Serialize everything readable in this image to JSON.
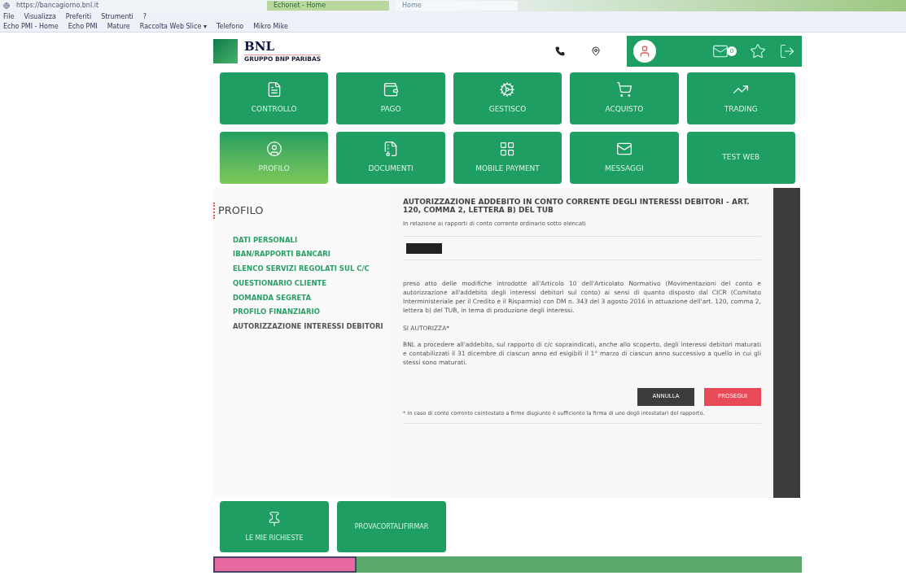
{
  "browser": {
    "address": "https://bancagiorno.bnl.it",
    "tabs": [
      {
        "label": "Echonet - Home",
        "selected": true
      },
      {
        "label": "Home",
        "selected": false
      }
    ],
    "menu": [
      "File",
      "Visualizza",
      "Preferiti",
      "Strumenti",
      "?"
    ],
    "bookmarks": [
      "Echo PMI - Home",
      "Echo PMI",
      "Mature",
      "Raccolta Web Slice ▾",
      "Telefono",
      "Mikro Mike"
    ]
  },
  "header": {
    "logo_name": "BNL",
    "logo_tagline": "GRUPPO BNP PARIBAS",
    "messages_badge": "0"
  },
  "tiles": [
    {
      "label": "CONTROLLO",
      "selected": false
    },
    {
      "label": "PAGO",
      "selected": false
    },
    {
      "label": "GESTISCO",
      "selected": false
    },
    {
      "label": "ACQUISTO",
      "selected": false
    },
    {
      "label": "TRADING",
      "selected": false
    },
    {
      "label": "PROFILO",
      "selected": true
    },
    {
      "label": "DOCUMENTI",
      "selected": false
    },
    {
      "label": "MOBILE PAYMENT",
      "selected": false
    },
    {
      "label": "MESSAGGI",
      "selected": false
    },
    {
      "label": "TEST WEB",
      "selected": false
    }
  ],
  "sidebar": {
    "title": "PROFILO",
    "items": [
      {
        "label": "DATI PERSONALI",
        "selected": false
      },
      {
        "label": "IBAN/RAPPORTI BANCARI",
        "selected": false
      },
      {
        "label": "ELENCO SERVIZI REGOLATI SUL C/C",
        "selected": false
      },
      {
        "label": "QUESTIONARIO CLIENTE",
        "selected": false
      },
      {
        "label": "DOMANDA SEGRETA",
        "selected": false
      },
      {
        "label": "PROFILO FINANZIARIO",
        "selected": false
      },
      {
        "label": "AUTORIZZAZIONE INTERESSI DEBITORI",
        "selected": true
      }
    ]
  },
  "main": {
    "title": "AUTORIZZAZIONE ADDEBITO IN CONTO CORRENTE DEGLI INTERESSI DEBITORI - ART. 120, COMMA 2, LETTERA B) DEL TUB",
    "intro": "In relazione ai rapporti di conto corrente ordinario sotto elencati",
    "paragraph_1": "preso atto delle modifiche introdotte all'Articolo 10 dell'Articolato Normativo (Movimentazioni del conto e autorizzazione all'addebito degli interessi debitori sul conto) ai sensi di quanto disposto dal CICR (Comitato Interministeriale per il Credito e il Risparmio) con DM n. 343 del 3 agosto 2016 in attuazione dell'art. 120, comma 2, lettera b) del TUB, in tema di produzione degli interessi.",
    "authorize_label": "SI AUTORIZZA*",
    "paragraph_2": "BNL a procedere all'addebito, sul rapporto di c/c sopraindicati, anche allo scoperto, degli interessi debitori maturati e contabilizzati il 31 dicembre di ciascun anno ed esigibili il 1° marzo di ciascun anno successivo a quello in cui gli stessi sono maturati.",
    "buttons": [
      {
        "label": "ANNULLA",
        "kind": "secondary"
      },
      {
        "label": "PROSEGUI",
        "kind": "primary"
      }
    ],
    "footnote": "* In caso di conto corrente cointestato a firme disgiunte è sufficiente la firma di uno degli intestatari del rapporto."
  },
  "bottom_tiles": [
    {
      "label": "LE MIE RICHIESTE"
    },
    {
      "label": "PROVACORTALIFIRMAR"
    }
  ]
}
